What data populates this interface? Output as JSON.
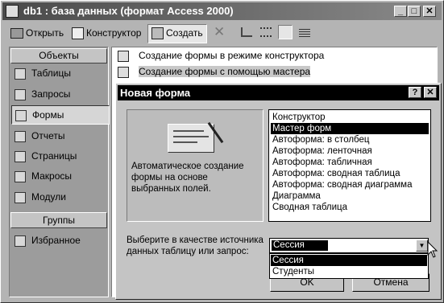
{
  "db_window": {
    "title": "db1 : база данных (формат Access 2000)",
    "toolbar": {
      "open_label": "Открыть",
      "design_label": "Конструктор",
      "create_label": "Создать"
    },
    "sidebar": {
      "objects_header": "Объекты",
      "items": [
        {
          "label": "Таблицы",
          "icon": "table-icon"
        },
        {
          "label": "Запросы",
          "icon": "query-icon"
        },
        {
          "label": "Формы",
          "icon": "form-icon"
        },
        {
          "label": "Отчеты",
          "icon": "report-icon"
        },
        {
          "label": "Страницы",
          "icon": "page-icon"
        },
        {
          "label": "Макросы",
          "icon": "macro-icon"
        },
        {
          "label": "Модули",
          "icon": "module-icon"
        }
      ],
      "groups_header": "Группы",
      "favorites_label": "Избранное"
    },
    "list_items": [
      "Создание формы в режиме конструктора",
      "Создание формы с помощью мастера"
    ]
  },
  "dialog": {
    "title": "Новая форма",
    "description": "Автоматическое создание формы на основе выбранных полей.",
    "options": [
      "Конструктор",
      "Мастер форм",
      "Автоформа: в столбец",
      "Автоформа: ленточная",
      "Автоформа: табличная",
      "Автоформа: сводная таблица",
      "Автоформа: сводная диаграмма",
      "Диаграмма",
      "Сводная таблица"
    ],
    "selected_option": "Мастер форм",
    "source_prompt": "Выберите в качестве источника данных таблицу или запрос:",
    "source_value": "Сессия",
    "dropdown_options": [
      "Сессия",
      "Студенты"
    ],
    "ok_label": "OK",
    "cancel_label": "Отмена"
  }
}
